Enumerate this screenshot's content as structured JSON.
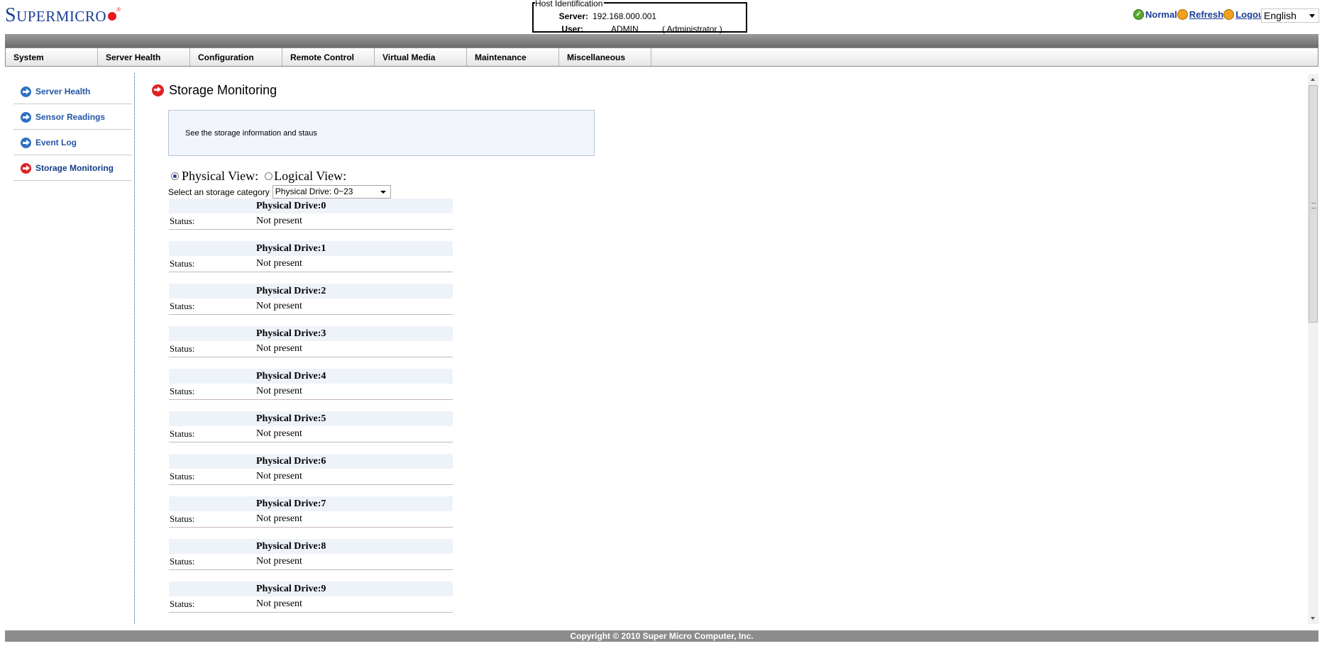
{
  "brand": {
    "logo_first": "S",
    "logo_rest": "UPERMICRO",
    "logo_mark": "®"
  },
  "host": {
    "legend": "Host Identification",
    "server_label": "Server:",
    "server_value": "192.168.000.001",
    "user_label": "User:",
    "user_value": "ADMIN",
    "user_role": "( Administrator )"
  },
  "status_links": {
    "normal": "Normal",
    "refresh": "Refresh",
    "logout": "Logout"
  },
  "language": {
    "selected": "English"
  },
  "nav": [
    "System",
    "Server Health",
    "Configuration",
    "Remote Control",
    "Virtual Media",
    "Maintenance",
    "Miscellaneous"
  ],
  "sidebar": {
    "items": [
      {
        "label": "Server Health"
      },
      {
        "label": "Sensor Readings"
      },
      {
        "label": "Event Log"
      },
      {
        "label": "Storage Monitoring"
      }
    ]
  },
  "page": {
    "title": "Storage Monitoring",
    "description": "See the storage information and staus",
    "physical_view": "Physical View:",
    "logical_view": "Logical View:",
    "category_label": "Select an storage category",
    "category_selected": "Physical Drive: 0~23"
  },
  "drives": [
    {
      "title": "Physical Drive:0",
      "status_label": "Status:",
      "status": "Not present"
    },
    {
      "title": "Physical Drive:1",
      "status_label": "Status:",
      "status": "Not present"
    },
    {
      "title": "Physical Drive:2",
      "status_label": "Status:",
      "status": "Not present"
    },
    {
      "title": "Physical Drive:3",
      "status_label": "Status:",
      "status": "Not present"
    },
    {
      "title": "Physical Drive:4",
      "status_label": "Status:",
      "status": "Not present"
    },
    {
      "title": "Physical Drive:5",
      "status_label": "Status:",
      "status": "Not present"
    },
    {
      "title": "Physical Drive:6",
      "status_label": "Status:",
      "status": "Not present"
    },
    {
      "title": "Physical Drive:7",
      "status_label": "Status:",
      "status": "Not present"
    },
    {
      "title": "Physical Drive:8",
      "status_label": "Status:",
      "status": "Not present"
    },
    {
      "title": "Physical Drive:9",
      "status_label": "Status:",
      "status": "Not present"
    }
  ],
  "footer": {
    "text": "Copyright © 2010 Super Micro Computer, Inc."
  }
}
